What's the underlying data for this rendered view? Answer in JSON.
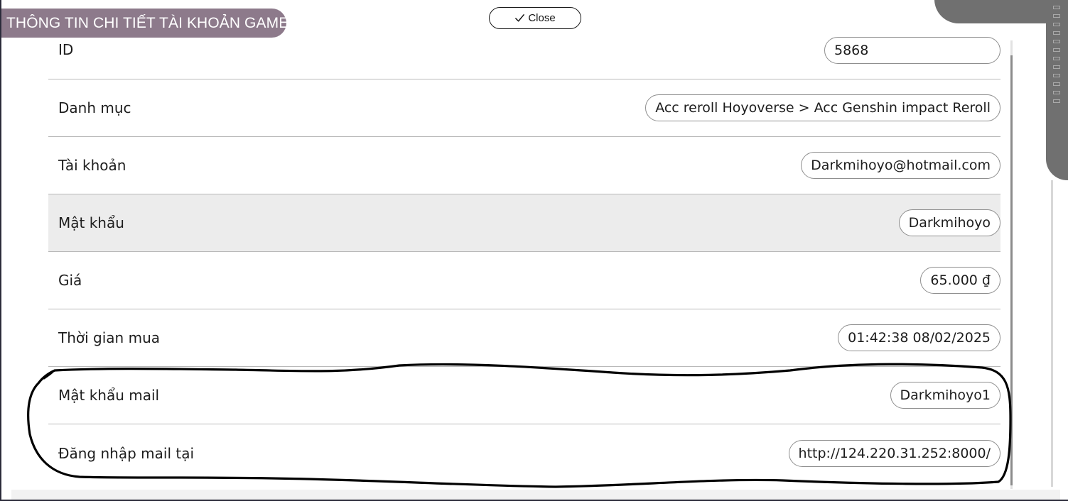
{
  "dialog": {
    "title": "THÔNG TIN CHI TIẾT TÀI KHOẢN GAME",
    "close_label": "Close"
  },
  "account": {
    "rows": [
      {
        "label": "ID",
        "value": "5868"
      },
      {
        "label": "Danh mục",
        "value": "Acc reroll Hoyoverse > Acc Genshin impact Reroll"
      },
      {
        "label": "Tài khoản",
        "value": "Darkmihoyo@hotmail.com"
      },
      {
        "label": "Mật khẩu",
        "value": "Darkmihoyo"
      },
      {
        "label": "Giá",
        "value": "65.000 ₫"
      },
      {
        "label": "Thời gian mua",
        "value": "01:42:38 08/02/2025"
      },
      {
        "label": "Mật khẩu mail",
        "value": "Darkmihoyo1"
      },
      {
        "label": "Đăng nhập mail tại",
        "value": "http://124.220.31.252:8000/"
      }
    ]
  },
  "colors": {
    "title_tab_bg": "#8d7a8b",
    "highlight_row_bg": "#ececec",
    "side_panel": "#707070",
    "annotation_stroke": "#000000"
  },
  "icons": {
    "close": "checkmark-icon"
  }
}
